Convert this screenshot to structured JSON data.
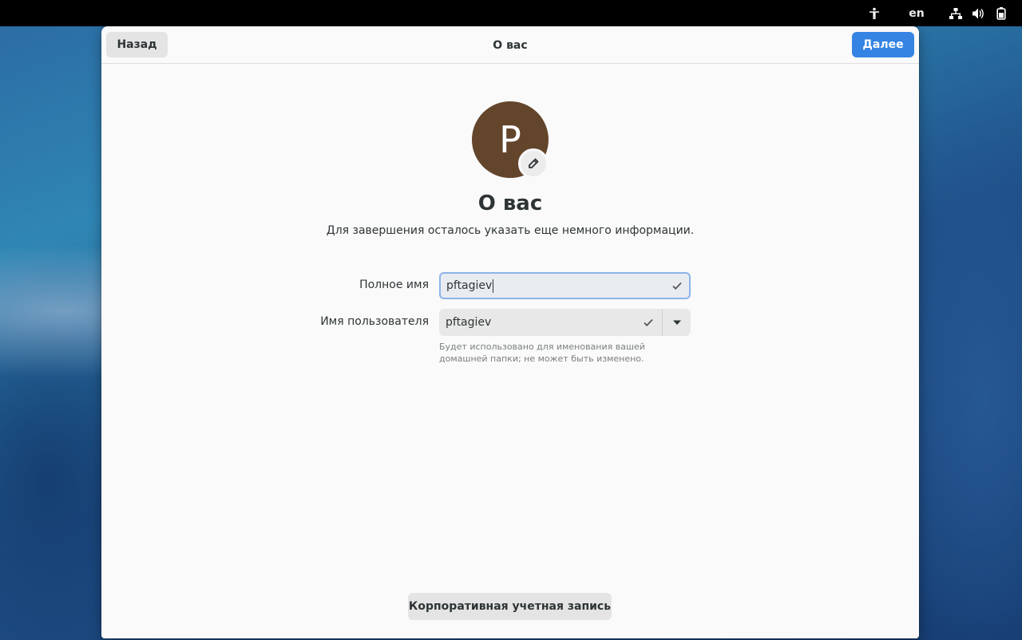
{
  "topbar": {
    "language": "en",
    "icons": [
      "accessibility-icon",
      "network-icon",
      "volume-icon",
      "battery-icon"
    ]
  },
  "header": {
    "back_label": "Назад",
    "title": "О вас",
    "next_label": "Далее"
  },
  "avatar": {
    "initial": "P",
    "color": "#63452c"
  },
  "page": {
    "heading": "О вас",
    "description": "Для завершения осталось указать еще немного информации."
  },
  "form": {
    "fullname_label": "Полное имя",
    "fullname_value": "pftagiev",
    "username_label": "Имя пользователя",
    "username_value": "pftagiev",
    "username_hint": "Будет использовано для именования вашей домашней папки; не может быть изменено."
  },
  "footer": {
    "enterprise_label": "Корпоративная учетная запись"
  },
  "colors": {
    "accent": "#3584e4",
    "focus_border": "#8cb4e8"
  }
}
